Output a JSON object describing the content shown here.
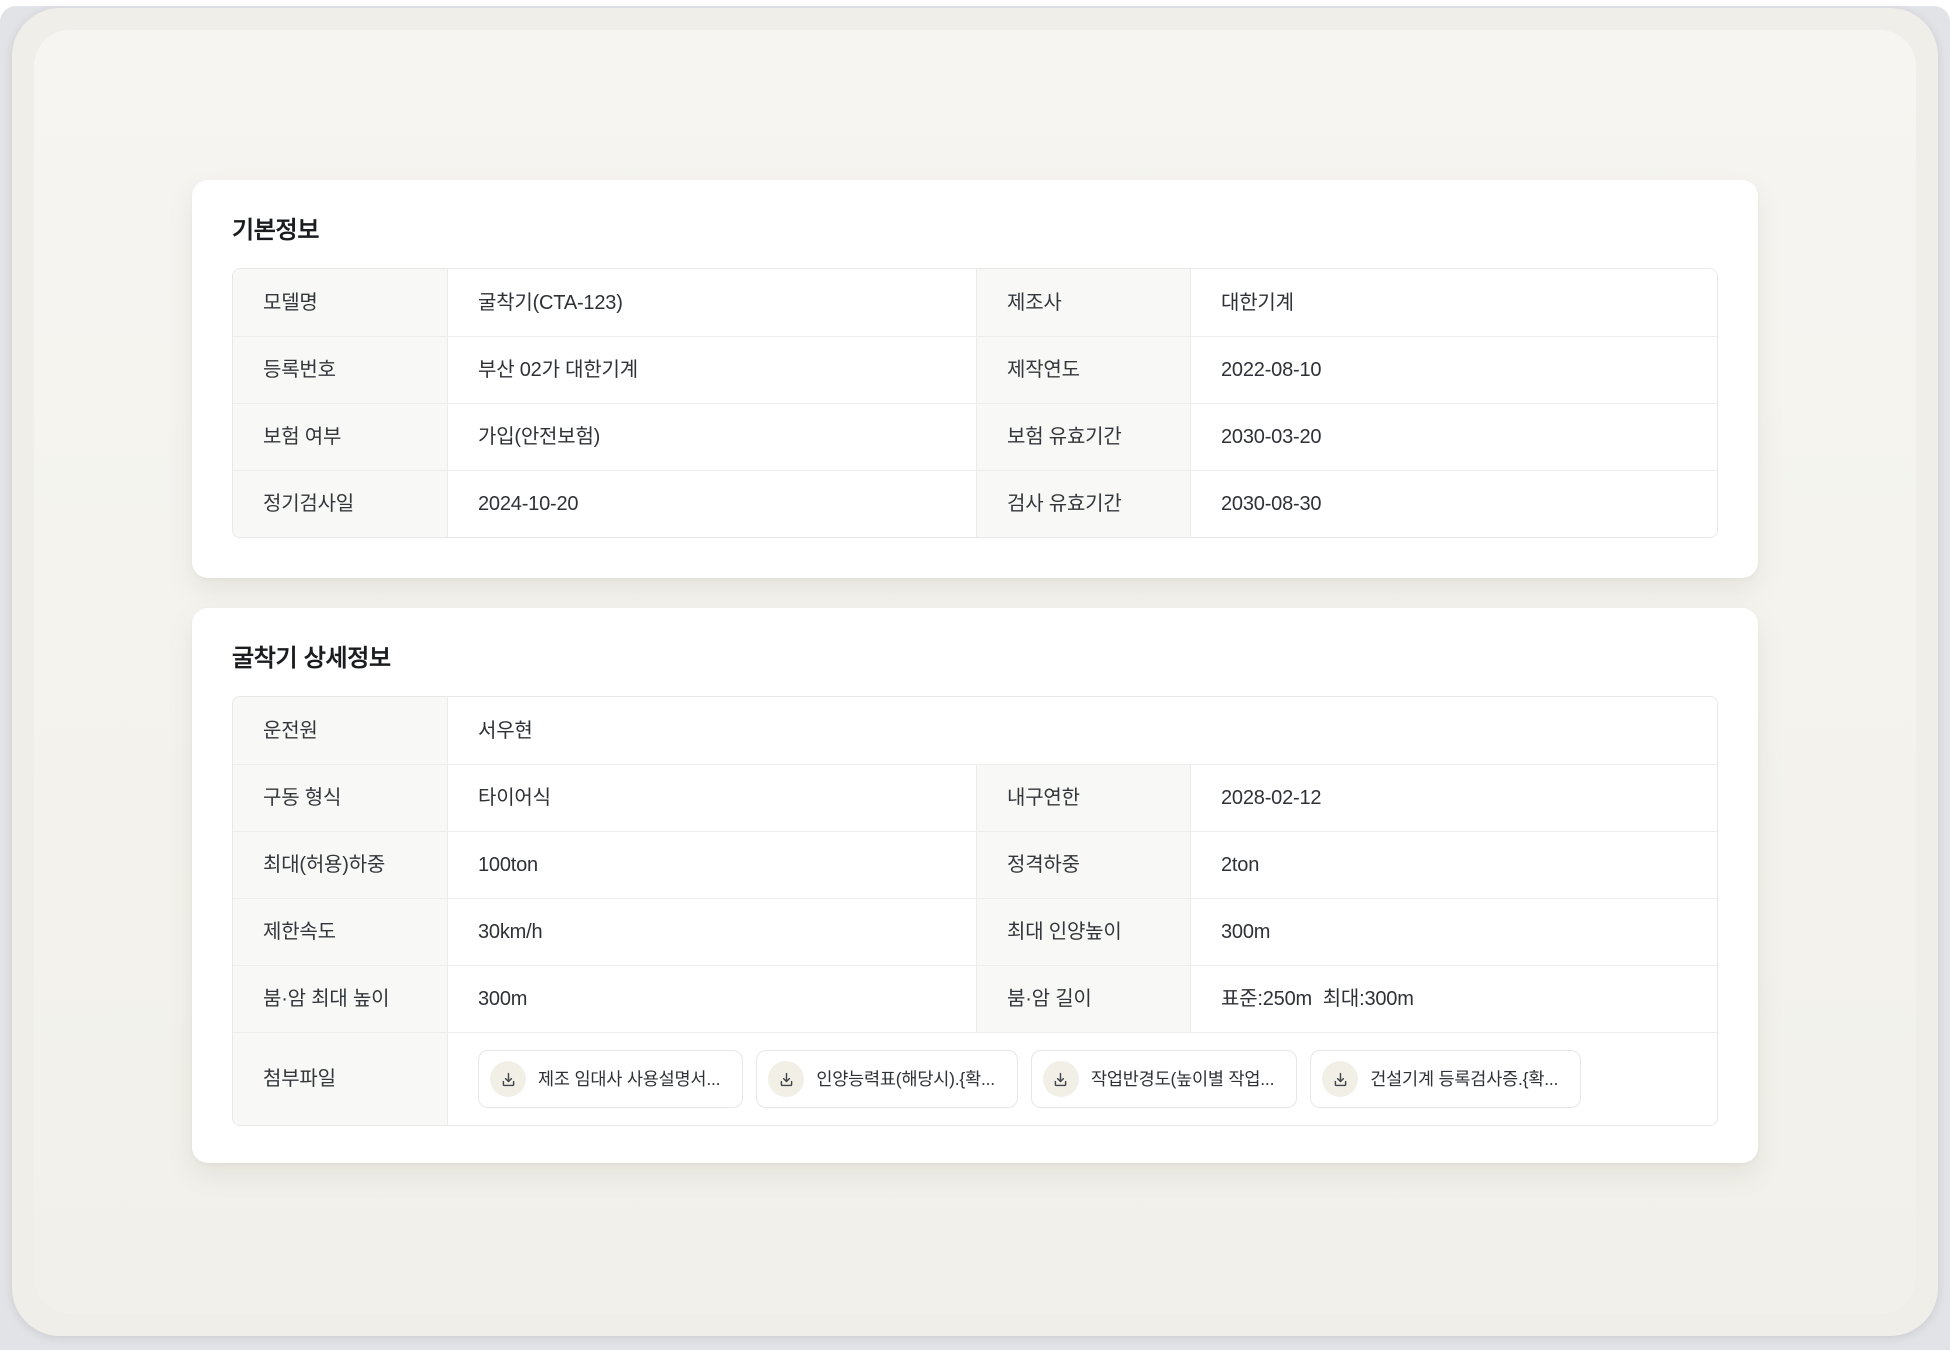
{
  "colors": {
    "page_bg": "#e2e3e7",
    "app_bg": "#f3f2ed",
    "card_bg": "#ffffff",
    "label_cell_bg": "#f8f8f6",
    "border": "#e8e8e6",
    "title_text": "#1a1c1f",
    "body_text": "#2e3136",
    "chip_icon_bg": "#f2efe7"
  },
  "basic_info": {
    "title": "기본정보",
    "rows": [
      {
        "label1": "모델명",
        "value1": "굴착기(CTA-123)",
        "label2": "제조사",
        "value2": "대한기계"
      },
      {
        "label1": "등록번호",
        "value1": "부산 02가 대한기계",
        "label2": "제작연도",
        "value2": "2022-08-10"
      },
      {
        "label1": "보험 여부",
        "value1": "가입(안전보험)",
        "label2": "보험 유효기간",
        "value2": "2030-03-20"
      },
      {
        "label1": "정기검사일",
        "value1": "2024-10-20",
        "label2": "검사 유효기간",
        "value2": "2030-08-30"
      }
    ]
  },
  "detail_info": {
    "title": "굴착기 상세정보",
    "operator_row": {
      "label": "운전원",
      "value": "서우현"
    },
    "rows": [
      {
        "label1": "구동 형식",
        "value1": "타이어식",
        "label2": "내구연한",
        "value2": "2028-02-12"
      },
      {
        "label1": "최대(허용)하중",
        "value1": "100ton",
        "label2": "정격하중",
        "value2": "2ton"
      },
      {
        "label1": "제한속도",
        "value1": "30km/h",
        "label2": "최대 인양높이",
        "value2": "300m"
      },
      {
        "label1": "붐·암 최대 높이",
        "value1": "300m",
        "label2": "붐·암 길이",
        "value2": "표준:250m  최대:300m"
      }
    ],
    "attachments": {
      "label": "첨부파일",
      "icon": "download-icon",
      "files": [
        "제조 임대사 사용설명서...",
        "인양능력표(해당시).{확...",
        "작업반경도(높이별 작업...",
        "건설기계 등록검사증.{확..."
      ]
    }
  }
}
